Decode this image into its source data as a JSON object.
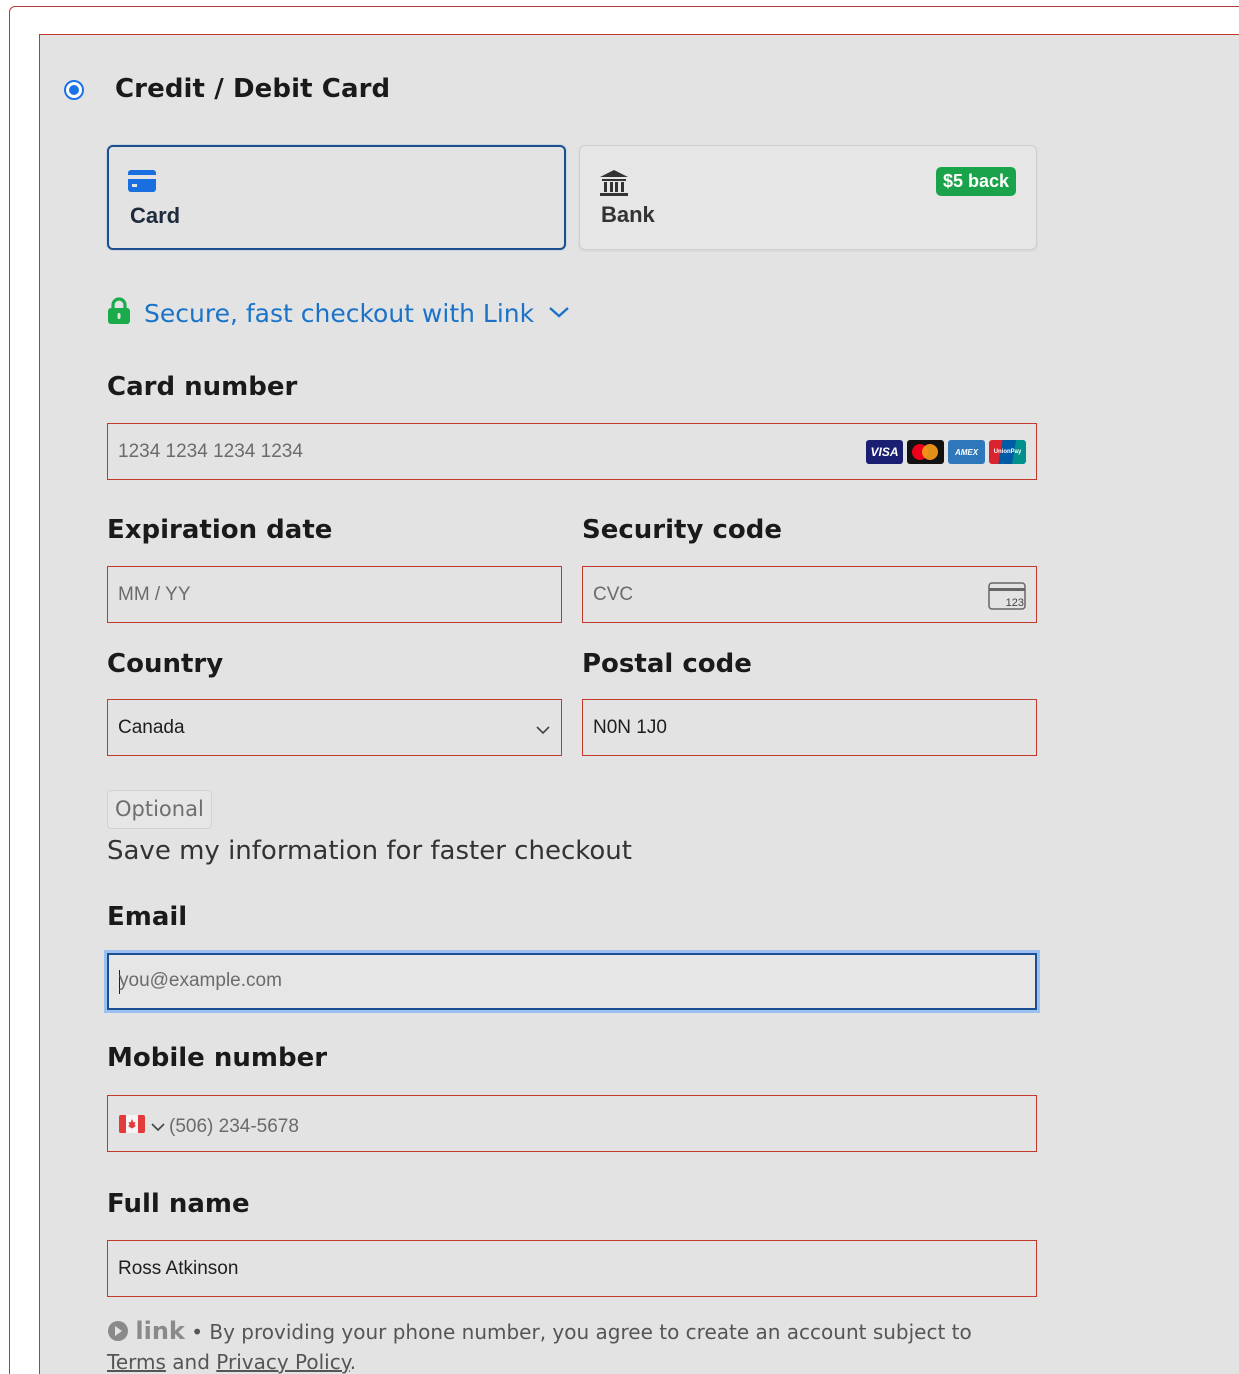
{
  "payment": {
    "method_title": "Credit / Debit Card",
    "tabs": [
      {
        "label": "Card",
        "icon": "credit-card-icon",
        "selected": true
      },
      {
        "label": "Bank",
        "icon": "bank-icon",
        "badge": "$5 back"
      }
    ]
  },
  "link": {
    "text": "Secure, fast checkout with Link",
    "icon": "lock-icon"
  },
  "card_number": {
    "label": "Card number",
    "placeholder": "1234 1234 1234 1234",
    "brands": [
      "VISA",
      "Mastercard",
      "AMEX",
      "UnionPay"
    ]
  },
  "expiration": {
    "label": "Expiration date",
    "placeholder": "MM / YY"
  },
  "security": {
    "label": "Security code",
    "placeholder": "CVC",
    "icon_text": "123"
  },
  "country": {
    "label": "Country",
    "value": "Canada"
  },
  "postal": {
    "label": "Postal code",
    "value": "N0N 1J0"
  },
  "save": {
    "optional": "Optional",
    "text": "Save my information for faster checkout"
  },
  "email": {
    "label": "Email",
    "placeholder": "you@example.com"
  },
  "mobile": {
    "label": "Mobile number",
    "placeholder": "(506) 234-5678"
  },
  "full_name": {
    "label": "Full name",
    "value": "Ross Atkinson"
  },
  "footer": {
    "logo": "link",
    "sep": "•",
    "text": "By providing your phone number, you agree to create an account subject to",
    "terms": "Terms",
    "and": "and",
    "privacy": "Privacy Policy",
    "end": "."
  },
  "colors": {
    "accent": "#1a73c9",
    "badge_green": "#1aa34a",
    "error_border": "#c0392b",
    "lock_green": "#1aab4b"
  }
}
